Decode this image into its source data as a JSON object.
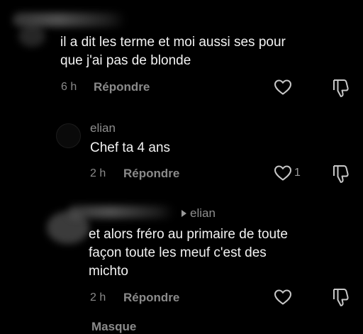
{
  "comments": [
    {
      "text": "il a dit les terme et moi aussi ses pour\nque j'ai pas de blonde",
      "time": "6 h",
      "reply_label": "Répondre"
    },
    {
      "username": "elian",
      "text": "Chef ta 4 ans",
      "time": "2 h",
      "reply_label": "Répondre",
      "like_count": "1"
    },
    {
      "reply_to": "elian",
      "text": "et alors fréro au primaire de toute\nfaçon toute les meuf c'est des\nmichto",
      "time": "2 h",
      "reply_label": "Répondre"
    }
  ],
  "hide_replies_label": "Masque",
  "icons": {
    "like": "heart-outline-icon",
    "dislike": "thumbs-down-outline-icon",
    "reply_indicator": "reply-arrow-icon"
  },
  "colors": {
    "background": "#000000",
    "primary_text": "#f2f2f2",
    "secondary_text": "#8a8a8a"
  }
}
